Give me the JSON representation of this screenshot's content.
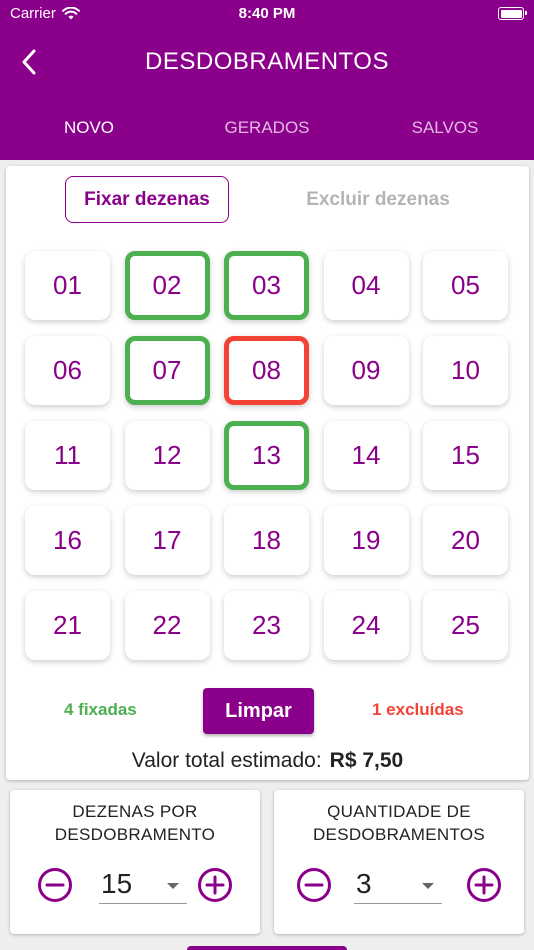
{
  "status_bar": {
    "carrier": "Carrier",
    "time": "8:40 PM"
  },
  "header": {
    "title": "DESDOBRAMENTOS"
  },
  "tabs": [
    {
      "label": "NOVO",
      "active": true
    },
    {
      "label": "GERADOS",
      "active": false
    },
    {
      "label": "SALVOS",
      "active": false
    }
  ],
  "mode": {
    "fix_label": "Fixar dezenas",
    "exclude_label": "Excluir dezenas"
  },
  "numbers": [
    {
      "label": "01",
      "state": "normal"
    },
    {
      "label": "02",
      "state": "fixed"
    },
    {
      "label": "03",
      "state": "fixed"
    },
    {
      "label": "04",
      "state": "normal"
    },
    {
      "label": "05",
      "state": "normal"
    },
    {
      "label": "06",
      "state": "normal"
    },
    {
      "label": "07",
      "state": "fixed"
    },
    {
      "label": "08",
      "state": "excluded"
    },
    {
      "label": "09",
      "state": "normal"
    },
    {
      "label": "10",
      "state": "normal"
    },
    {
      "label": "11",
      "state": "normal"
    },
    {
      "label": "12",
      "state": "normal"
    },
    {
      "label": "13",
      "state": "fixed"
    },
    {
      "label": "14",
      "state": "normal"
    },
    {
      "label": "15",
      "state": "normal"
    },
    {
      "label": "16",
      "state": "normal"
    },
    {
      "label": "17",
      "state": "normal"
    },
    {
      "label": "18",
      "state": "normal"
    },
    {
      "label": "19",
      "state": "normal"
    },
    {
      "label": "20",
      "state": "normal"
    },
    {
      "label": "21",
      "state": "normal"
    },
    {
      "label": "22",
      "state": "normal"
    },
    {
      "label": "23",
      "state": "normal"
    },
    {
      "label": "24",
      "state": "normal"
    },
    {
      "label": "25",
      "state": "normal"
    }
  ],
  "summary": {
    "fixed_text": "4 fixadas",
    "clear_label": "Limpar",
    "excluded_text": "1 excluídas",
    "total_label": "Valor total estimado:",
    "total_value": "R$ 7,50"
  },
  "config": {
    "per_unfold": {
      "label": "DEZENAS POR\nDESDOBRAMENTO",
      "value": "15"
    },
    "quantity": {
      "label": "QUANTIDADE DE\nDESDOBRAMENTOS",
      "value": "3"
    }
  },
  "colors": {
    "primary": "#8b008b",
    "fixed": "#4caf50",
    "excluded": "#f44336",
    "inactive": "#b4b4b4"
  },
  "icons": {
    "back": "chevron-left-icon",
    "minus": "minus-circle-icon",
    "plus": "plus-circle-icon",
    "wifi": "wifi-icon",
    "battery": "battery-icon"
  }
}
